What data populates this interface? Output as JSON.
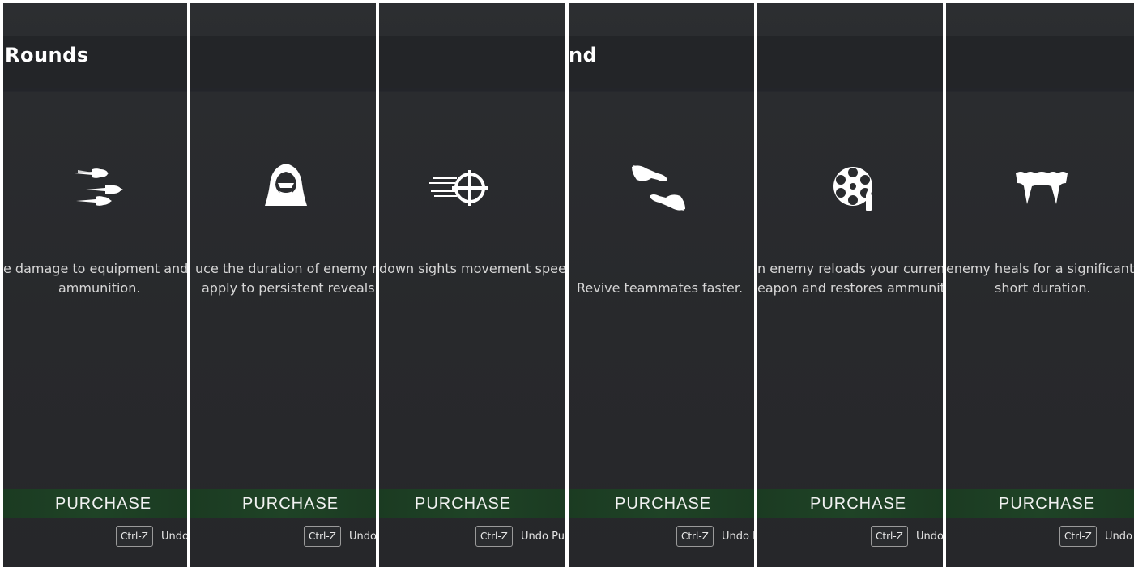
{
  "panels": [
    {
      "title": "Rounds",
      "icon": "triple-rounds-icon",
      "desc_line1": "e damage to equipment and d",
      "desc_line2": "ammunition.",
      "purchase_label": "PURCHASE",
      "shortcut_key": "Ctrl-Z",
      "shortcut_label": "Undo"
    },
    {
      "title": "",
      "icon": "hooded-figure-icon",
      "desc_line1": "uce the duration of enemy rev",
      "desc_line2": "apply to persistent reveals.",
      "purchase_label": "PURCHASE",
      "shortcut_key": "Ctrl-Z",
      "shortcut_label": "Undo"
    },
    {
      "title": "",
      "icon": "speed-crosshair-icon",
      "desc_line1": "down sights movement spee",
      "desc_line2": "",
      "purchase_label": "PURCHASE",
      "shortcut_key": "Ctrl-Z",
      "shortcut_label": "Undo Pu"
    },
    {
      "title": "nd",
      "icon": "helping-hands-icon",
      "desc_line1": "Revive teammates faster.",
      "desc_line2": "",
      "purchase_label": "PURCHASE",
      "shortcut_key": "Ctrl-Z",
      "shortcut_label": "Undo P"
    },
    {
      "title": "",
      "icon": "revolver-cylinder-icon",
      "desc_line1": "n enemy reloads your current",
      "desc_line2": "eapon and restores ammuniti",
      "purchase_label": "PURCHASE",
      "shortcut_key": "Ctrl-Z",
      "shortcut_label": "Undo"
    },
    {
      "title": "",
      "icon": "fangs-icon",
      "desc_line1": "enemy heals for a significant a",
      "desc_line2": "short duration.",
      "purchase_label": "PURCHASE",
      "shortcut_key": "Ctrl-Z",
      "shortcut_label": "Undo"
    }
  ],
  "colors": {
    "panel_bg": "#28292c",
    "header_band": "#232528",
    "purchase_bg": "#1f4326",
    "text": "#d6d6d6"
  }
}
